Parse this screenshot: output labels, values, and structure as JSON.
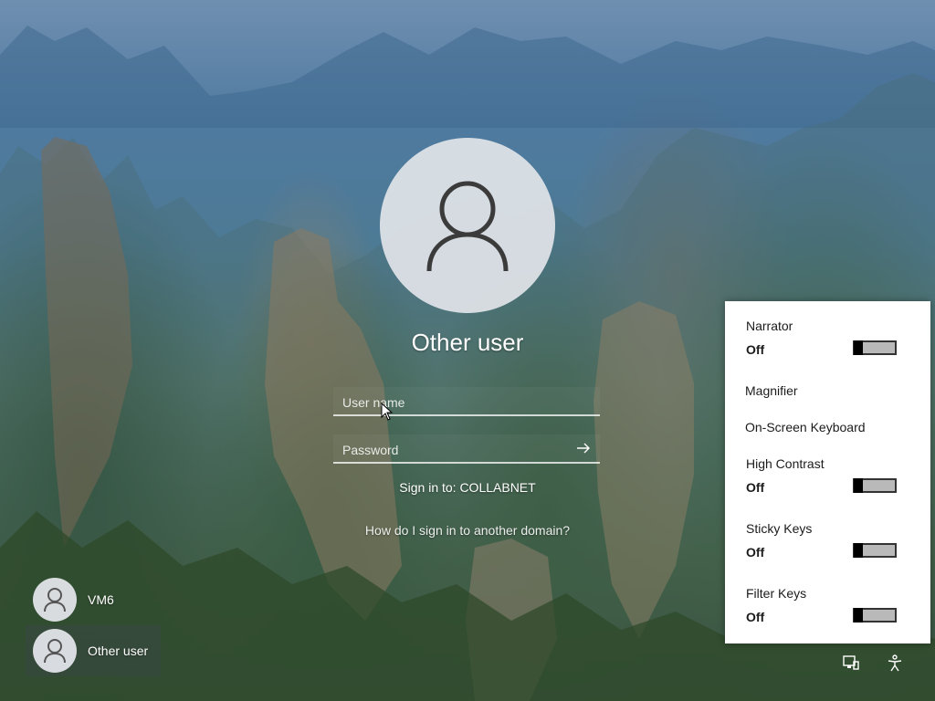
{
  "login": {
    "user_title": "Other user",
    "username_placeholder": "User name",
    "username_value": "",
    "password_placeholder": "Password",
    "password_value": "",
    "sign_in_to": "Sign in to: COLLABNET",
    "domain_help_link": "How do I sign in to another domain?"
  },
  "users": [
    {
      "name": "VM6",
      "selected": false
    },
    {
      "name": "Other user",
      "selected": true
    }
  ],
  "accessibility": {
    "narrator": {
      "label": "Narrator",
      "state": "Off"
    },
    "magnifier": {
      "label": "Magnifier"
    },
    "onscreen_keyboard": {
      "label": "On-Screen Keyboard"
    },
    "high_contrast": {
      "label": "High Contrast",
      "state": "Off"
    },
    "sticky_keys": {
      "label": "Sticky Keys",
      "state": "Off"
    },
    "filter_keys": {
      "label": "Filter Keys",
      "state": "Off"
    }
  },
  "tray": {
    "icons": [
      "network-icon",
      "accessibility-icon"
    ]
  },
  "colors": {
    "text": "#ffffff",
    "flyout_bg": "#ffffff",
    "toggle_off": "#b9b9b9"
  }
}
